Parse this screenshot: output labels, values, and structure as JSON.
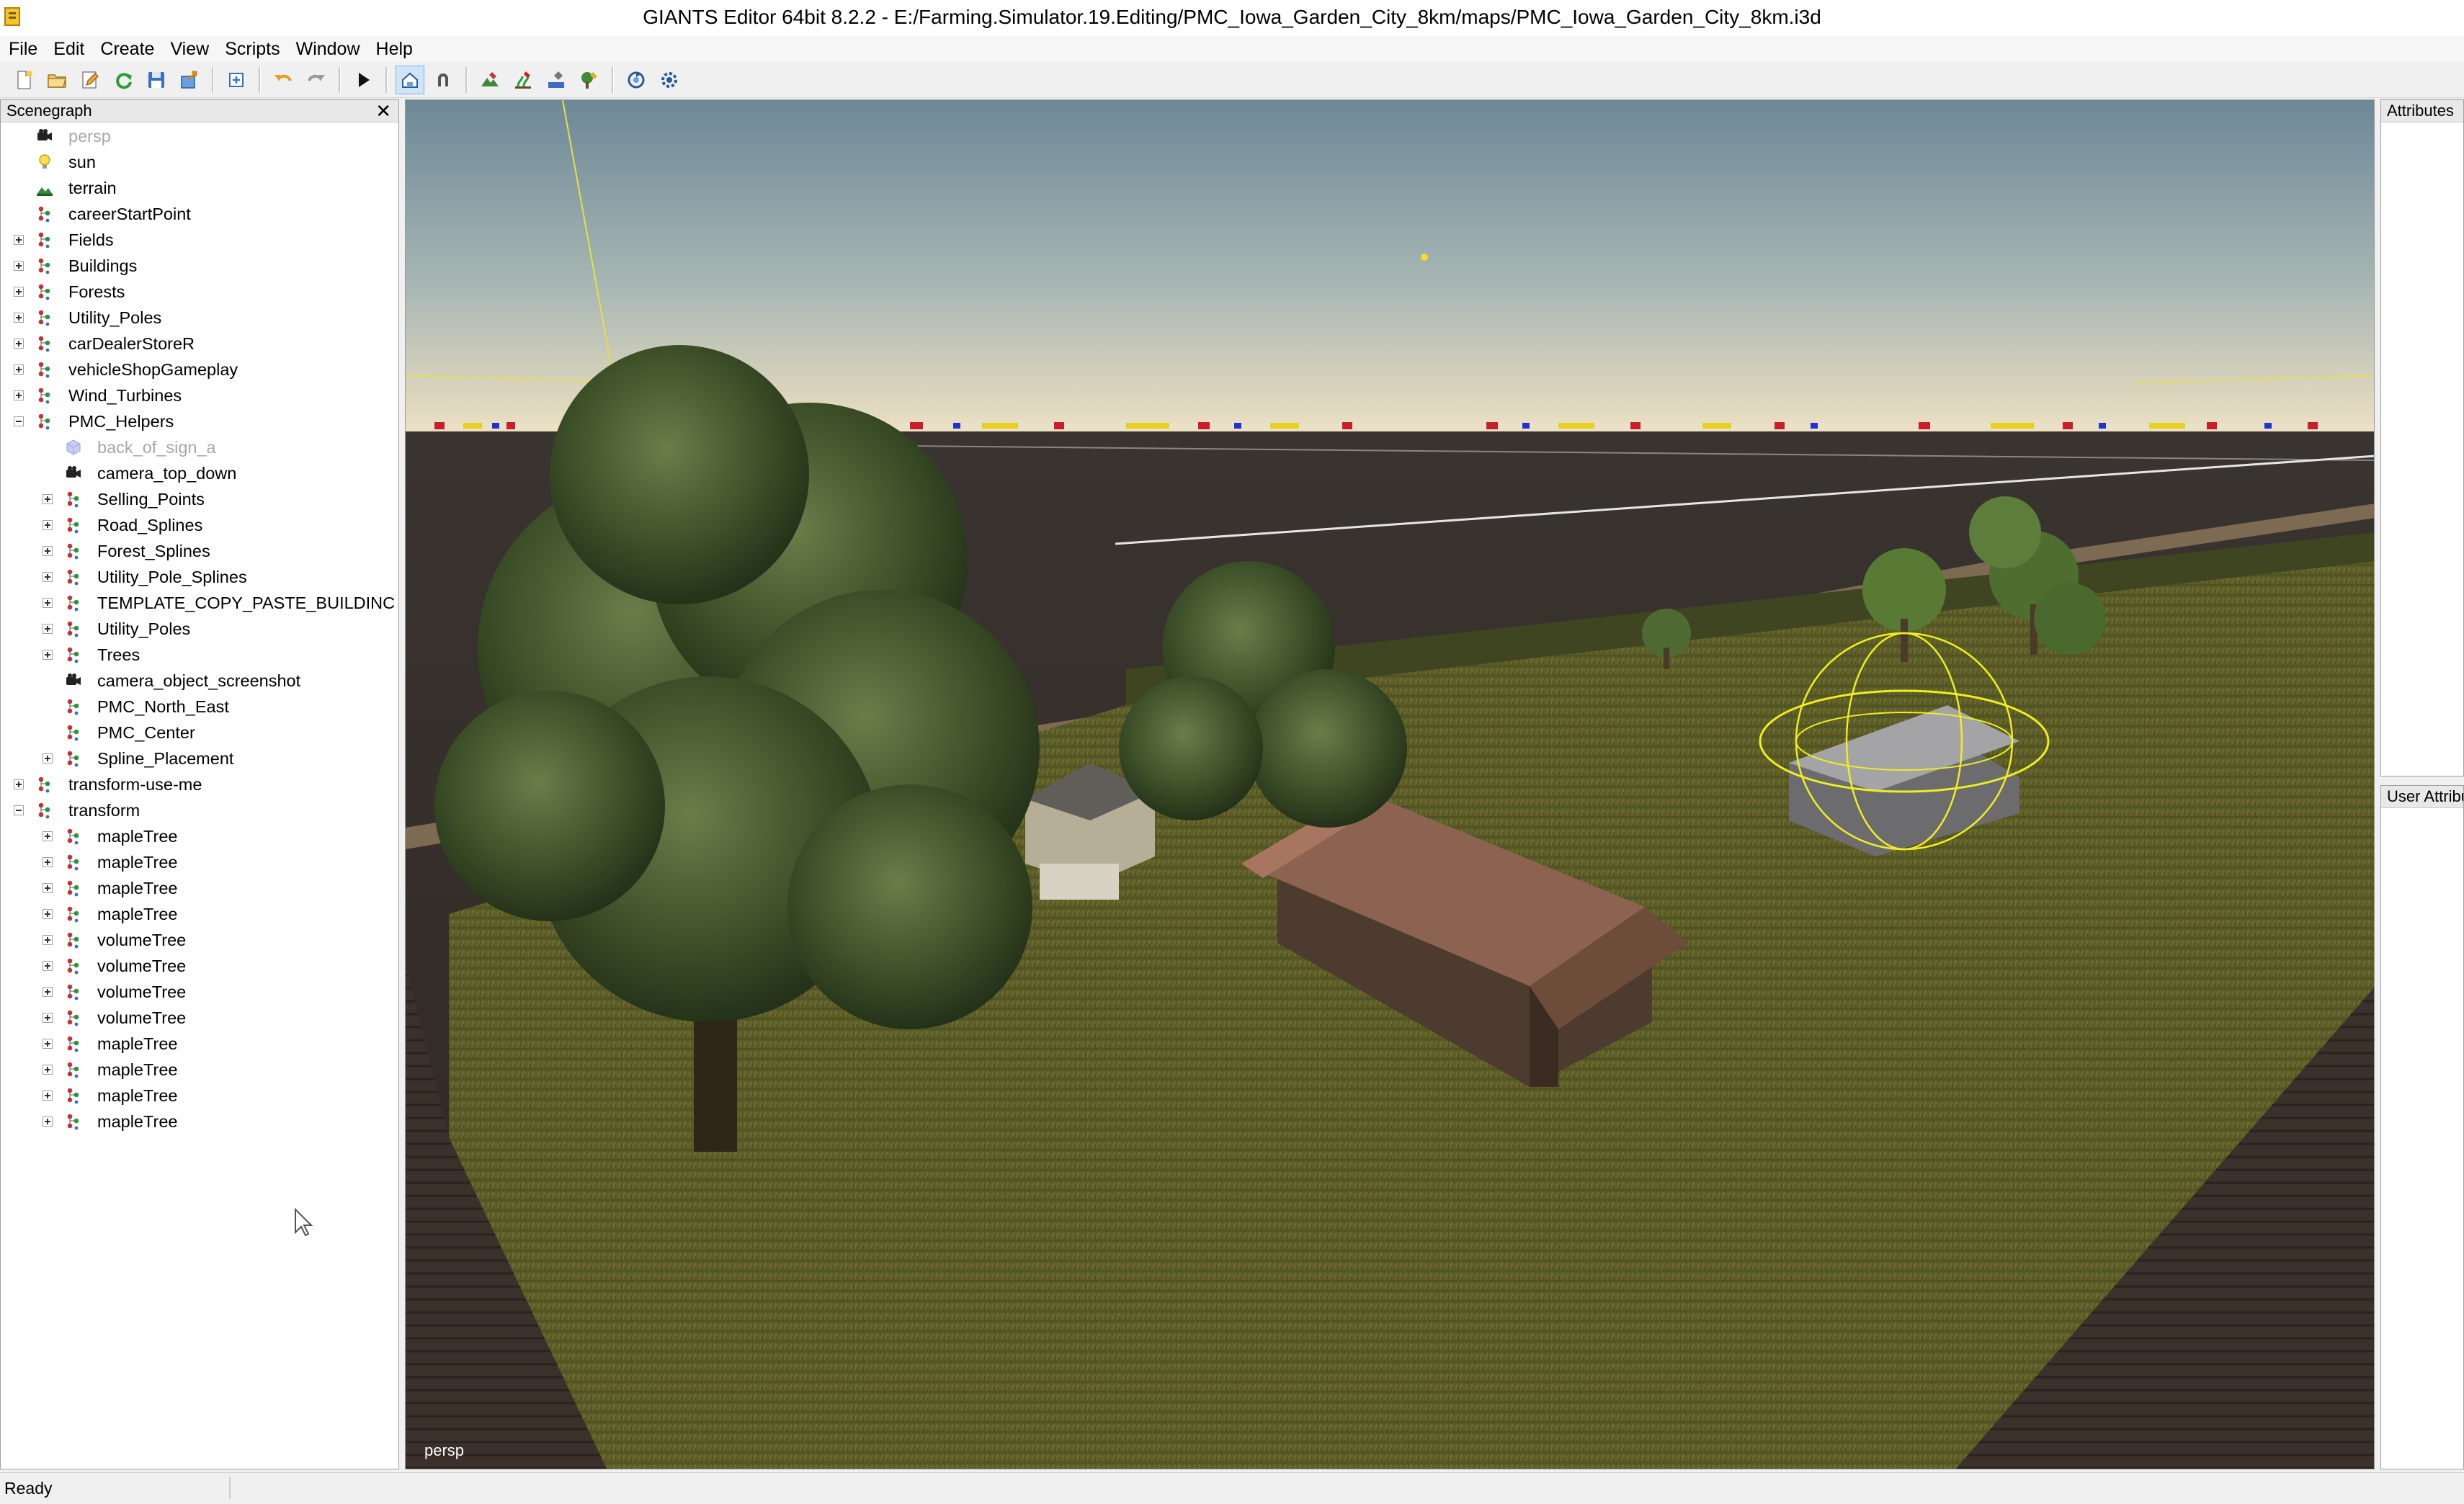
{
  "window": {
    "title": "GIANTS Editor 64bit 8.2.2 - E:/Farming.Simulator.19.Editing/PMC_Iowa_Garden_City_8km/maps/PMC_Iowa_Garden_City_8km.i3d"
  },
  "menubar": {
    "items": [
      {
        "label": "File"
      },
      {
        "label": "Edit"
      },
      {
        "label": "Create"
      },
      {
        "label": "View"
      },
      {
        "label": "Scripts"
      },
      {
        "label": "Window"
      },
      {
        "label": "Help"
      }
    ]
  },
  "toolbar": {
    "icons": [
      "new-file-icon",
      "open-file-icon",
      "edit-icon",
      "reload-icon",
      "save-icon",
      "export-icon",
      "import-icon",
      "undo-icon",
      "redo-icon",
      "play-icon",
      "select-mode-icon",
      "magnet-icon",
      "terrain-paint-icon",
      "foliage-paint-icon",
      "texture-paint-icon",
      "tree-paint-icon",
      "refresh-icon",
      "settings-icon"
    ]
  },
  "scenegraph": {
    "title": "Scenegraph",
    "close_symbol": "✕",
    "rows": [
      {
        "label": "persp",
        "icon": "camera",
        "depth": 0,
        "expander": "",
        "disabled": true
      },
      {
        "label": "sun",
        "icon": "light",
        "depth": 0,
        "expander": "",
        "disabled": false
      },
      {
        "label": "terrain",
        "icon": "terrain",
        "depth": 0,
        "expander": "",
        "disabled": false
      },
      {
        "label": "careerStartPoint",
        "icon": "transform",
        "depth": 0,
        "expander": "",
        "disabled": false
      },
      {
        "label": "Fields",
        "icon": "transform",
        "depth": 0,
        "expander": "plus",
        "disabled": false
      },
      {
        "label": "Buildings",
        "icon": "transform",
        "depth": 0,
        "expander": "plus",
        "disabled": false
      },
      {
        "label": "Forests",
        "icon": "transform",
        "depth": 0,
        "expander": "plus",
        "disabled": false
      },
      {
        "label": "Utility_Poles",
        "icon": "transform",
        "depth": 0,
        "expander": "plus",
        "disabled": false
      },
      {
        "label": "carDealerStoreR",
        "icon": "transform",
        "depth": 0,
        "expander": "plus",
        "disabled": false
      },
      {
        "label": "vehicleShopGameplay",
        "icon": "transform",
        "depth": 0,
        "expander": "plus",
        "disabled": false
      },
      {
        "label": "Wind_Turbines",
        "icon": "transform",
        "depth": 0,
        "expander": "plus",
        "disabled": false
      },
      {
        "label": "PMC_Helpers",
        "icon": "transform",
        "depth": 0,
        "expander": "minus",
        "disabled": false
      },
      {
        "label": "back_of_sign_a",
        "icon": "shape",
        "depth": 1,
        "expander": "",
        "disabled": true
      },
      {
        "label": "camera_top_down",
        "icon": "camera",
        "depth": 1,
        "expander": "",
        "disabled": false
      },
      {
        "label": "Selling_Points",
        "icon": "transform",
        "depth": 1,
        "expander": "plus",
        "disabled": false
      },
      {
        "label": "Road_Splines",
        "icon": "transform",
        "depth": 1,
        "expander": "plus",
        "disabled": false
      },
      {
        "label": "Forest_Splines",
        "icon": "transform",
        "depth": 1,
        "expander": "plus",
        "disabled": false
      },
      {
        "label": "Utility_Pole_Splines",
        "icon": "transform",
        "depth": 1,
        "expander": "plus",
        "disabled": false
      },
      {
        "label": "TEMPLATE_COPY_PASTE_BUILDINC",
        "icon": "transform",
        "depth": 1,
        "expander": "plus",
        "disabled": false
      },
      {
        "label": "Utility_Poles",
        "icon": "transform",
        "depth": 1,
        "expander": "plus",
        "disabled": false
      },
      {
        "label": "Trees",
        "icon": "transform",
        "depth": 1,
        "expander": "plus",
        "disabled": false
      },
      {
        "label": "camera_object_screenshot",
        "icon": "camera",
        "depth": 1,
        "expander": "",
        "disabled": false
      },
      {
        "label": "PMC_North_East",
        "icon": "transform",
        "depth": 1,
        "expander": "",
        "disabled": false
      },
      {
        "label": "PMC_Center",
        "icon": "transform",
        "depth": 1,
        "expander": "",
        "disabled": false
      },
      {
        "label": "Spline_Placement",
        "icon": "transform",
        "depth": 1,
        "expander": "plus",
        "disabled": false
      },
      {
        "label": "transform-use-me",
        "icon": "transform",
        "depth": 0,
        "expander": "plus",
        "disabled": false
      },
      {
        "label": "transform",
        "icon": "transform",
        "depth": 0,
        "expander": "minus",
        "disabled": false
      },
      {
        "label": "mapleTree",
        "icon": "transform",
        "depth": 1,
        "expander": "plus",
        "disabled": false
      },
      {
        "label": "mapleTree",
        "icon": "transform",
        "depth": 1,
        "expander": "plus",
        "disabled": false
      },
      {
        "label": "mapleTree",
        "icon": "transform",
        "depth": 1,
        "expander": "plus",
        "disabled": false
      },
      {
        "label": "mapleTree",
        "icon": "transform",
        "depth": 1,
        "expander": "plus",
        "disabled": false
      },
      {
        "label": "volumeTree",
        "icon": "transform",
        "depth": 1,
        "expander": "plus",
        "disabled": false
      },
      {
        "label": "volumeTree",
        "icon": "transform",
        "depth": 1,
        "expander": "plus",
        "disabled": false
      },
      {
        "label": "volumeTree",
        "icon": "transform",
        "depth": 1,
        "expander": "plus",
        "disabled": false
      },
      {
        "label": "volumeTree",
        "icon": "transform",
        "depth": 1,
        "expander": "plus",
        "disabled": false
      },
      {
        "label": "mapleTree",
        "icon": "transform",
        "depth": 1,
        "expander": "plus",
        "disabled": false
      },
      {
        "label": "mapleTree",
        "icon": "transform",
        "depth": 1,
        "expander": "plus",
        "disabled": false
      },
      {
        "label": "mapleTree",
        "icon": "transform",
        "depth": 1,
        "expander": "plus",
        "disabled": false
      },
      {
        "label": "mapleTree",
        "icon": "transform",
        "depth": 1,
        "expander": "plus",
        "disabled": false
      }
    ]
  },
  "viewport": {
    "camera_label": "persp"
  },
  "attributes_panel": {
    "title": "Attributes"
  },
  "user_attributes_panel": {
    "title": "User Attributes"
  },
  "statusbar": {
    "text": "Ready"
  },
  "colors": {
    "sky_top": "#6f8a9a",
    "sky_horizon": "#e9dcc0",
    "field_dark": "#3a322c",
    "grass": "#5d5f26",
    "selection_yellow": "#f0f020"
  }
}
